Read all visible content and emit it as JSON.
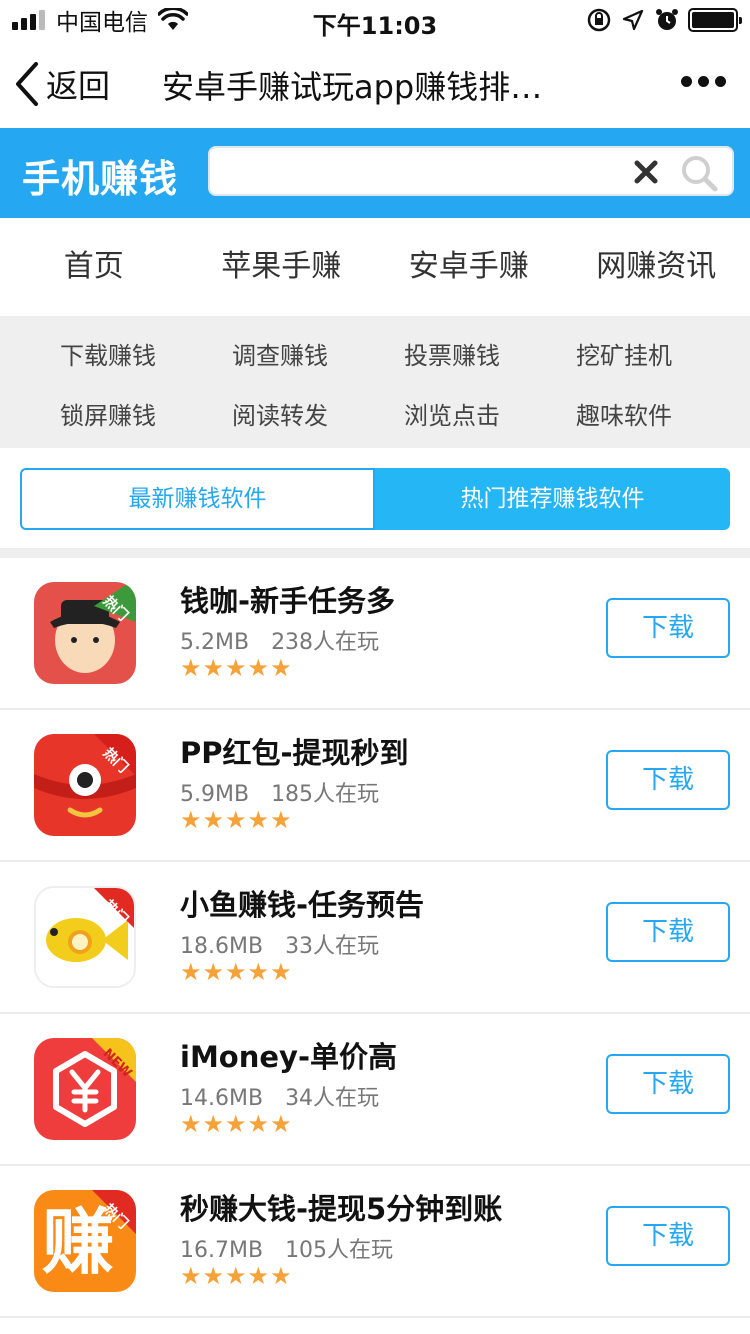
{
  "status_bar": {
    "carrier": "中国电信",
    "time": "下午11:03"
  },
  "nav": {
    "back_label": "返回",
    "title": "安卓手赚试玩app赚钱排…"
  },
  "header": {
    "logo_text": "手机赚钱",
    "search_value": "",
    "search_placeholder": ""
  },
  "main_tabs": [
    "首页",
    "苹果手赚",
    "安卓手赚",
    "网赚资讯"
  ],
  "categories": [
    "下载赚钱",
    "调查赚钱",
    "投票赚钱",
    "挖矿挂机",
    "锁屏赚钱",
    "阅读转发",
    "浏览点击",
    "趣味软件"
  ],
  "toggle": {
    "left_label": "最新赚钱软件",
    "right_label": "热门推荐赚钱软件"
  },
  "apps": [
    {
      "name": "钱咖-新手任务多",
      "size": "5.2MB",
      "players": "238人在玩",
      "stars": "★★★★★",
      "badge": "热门",
      "button": "下载",
      "icon": "qianka-icon"
    },
    {
      "name": "PP红包-提现秒到",
      "size": "5.9MB",
      "players": "185人在玩",
      "stars": "★★★★★",
      "badge": "热门",
      "button": "下载",
      "icon": "pp-hongbao-icon"
    },
    {
      "name": "小鱼赚钱-任务预告",
      "size": "18.6MB",
      "players": "33人在玩",
      "stars": "★★★★★",
      "badge": "热门",
      "button": "下载",
      "icon": "xiaoyu-fish-icon"
    },
    {
      "name": "iMoney-单价高",
      "size": "14.6MB",
      "players": "34人在玩",
      "stars": "★★★★★",
      "badge": "NEW",
      "button": "下载",
      "icon": "imoney-yuan-icon"
    },
    {
      "name": "秒赚大钱-提现5分钟到账",
      "size": "16.7MB",
      "players": "105人在玩",
      "stars": "★★★★★",
      "badge": "热门",
      "button": "下载",
      "icon": "miaozhuan-icon",
      "icon_char": "赚"
    }
  ]
}
